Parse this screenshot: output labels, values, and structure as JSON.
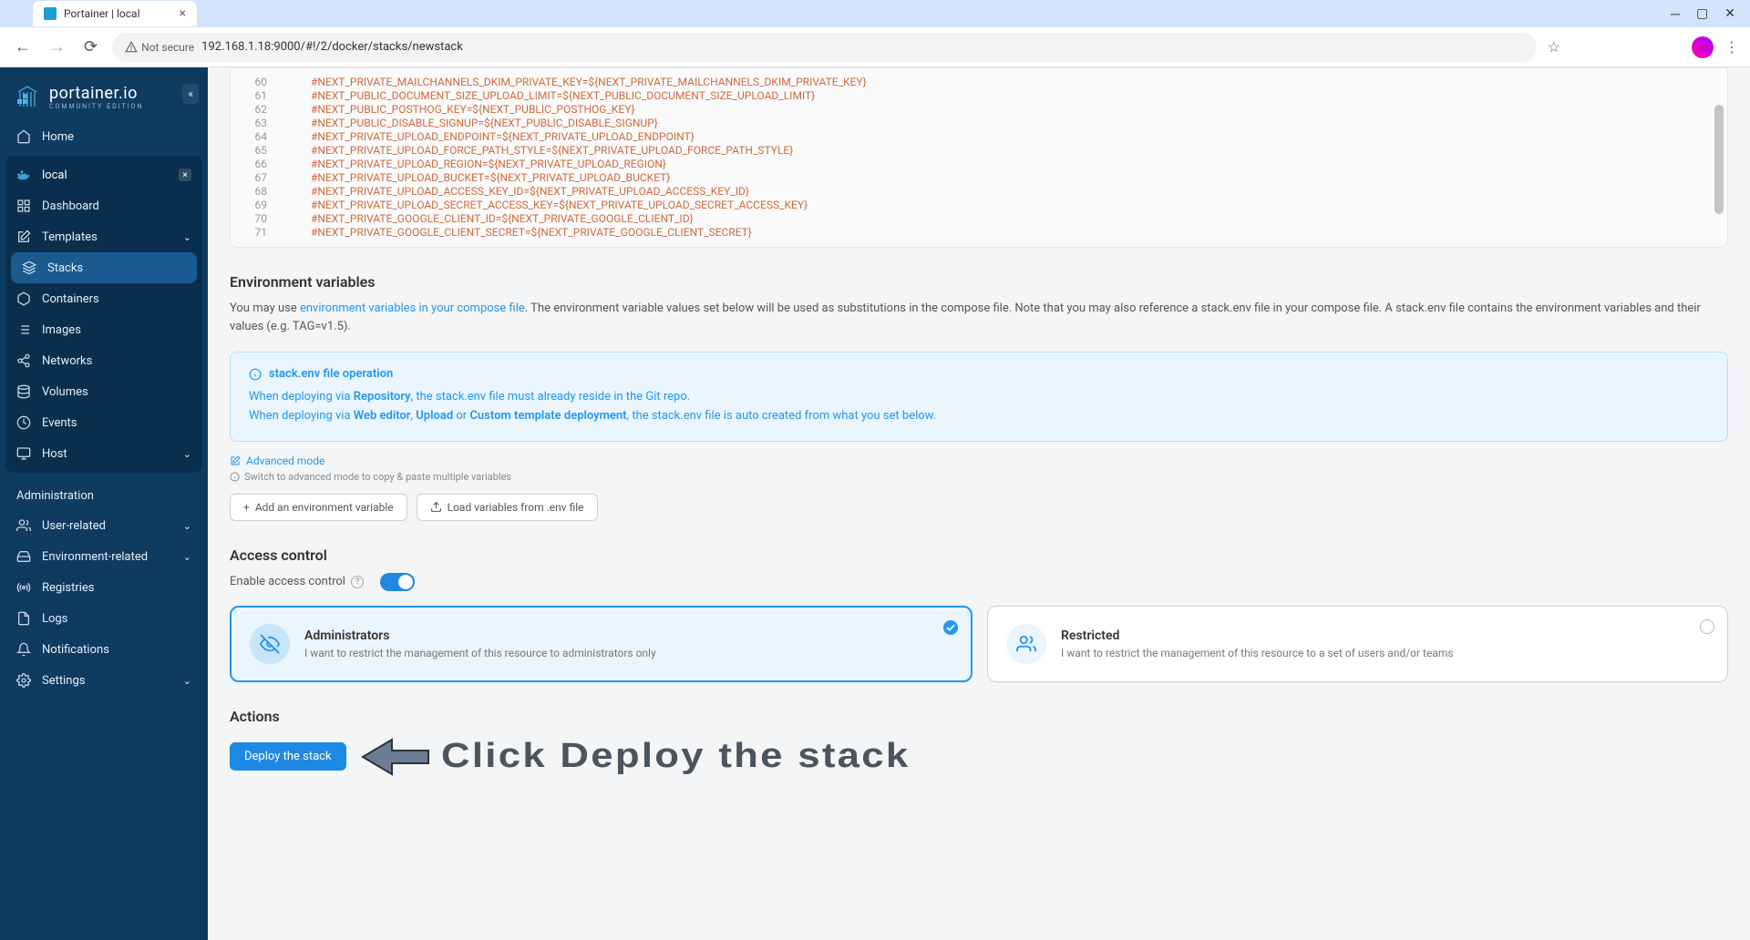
{
  "browser": {
    "tab_title": "Portainer | local",
    "not_secure": "Not secure",
    "url": "192.168.1.18:9000/#!/2/docker/stacks/newstack"
  },
  "sidebar": {
    "logo_main": "portainer.io",
    "logo_sub": "COMMUNITY EDITION",
    "home": "Home",
    "env_name": "local",
    "items": [
      "Dashboard",
      "Templates",
      "Stacks",
      "Containers",
      "Images",
      "Networks",
      "Volumes",
      "Events",
      "Host"
    ],
    "admin_header": "Administration",
    "admin_items": [
      "User-related",
      "Environment-related",
      "Registries",
      "Logs",
      "Notifications",
      "Settings"
    ]
  },
  "code": {
    "lines": [
      {
        "n": 60,
        "t": "#NEXT_PRIVATE_MAILCHANNELS_DKIM_PRIVATE_KEY=${NEXT_PRIVATE_MAILCHANNELS_DKIM_PRIVATE_KEY}"
      },
      {
        "n": 61,
        "t": "#NEXT_PUBLIC_DOCUMENT_SIZE_UPLOAD_LIMIT=${NEXT_PUBLIC_DOCUMENT_SIZE_UPLOAD_LIMIT}"
      },
      {
        "n": 62,
        "t": "#NEXT_PUBLIC_POSTHOG_KEY=${NEXT_PUBLIC_POSTHOG_KEY}"
      },
      {
        "n": 63,
        "t": "#NEXT_PUBLIC_DISABLE_SIGNUP=${NEXT_PUBLIC_DISABLE_SIGNUP}"
      },
      {
        "n": 64,
        "t": "#NEXT_PRIVATE_UPLOAD_ENDPOINT=${NEXT_PRIVATE_UPLOAD_ENDPOINT}"
      },
      {
        "n": 65,
        "t": "#NEXT_PRIVATE_UPLOAD_FORCE_PATH_STYLE=${NEXT_PRIVATE_UPLOAD_FORCE_PATH_STYLE}"
      },
      {
        "n": 66,
        "t": "#NEXT_PRIVATE_UPLOAD_REGION=${NEXT_PRIVATE_UPLOAD_REGION}"
      },
      {
        "n": 67,
        "t": "#NEXT_PRIVATE_UPLOAD_BUCKET=${NEXT_PRIVATE_UPLOAD_BUCKET}"
      },
      {
        "n": 68,
        "t": "#NEXT_PRIVATE_UPLOAD_ACCESS_KEY_ID=${NEXT_PRIVATE_UPLOAD_ACCESS_KEY_ID}"
      },
      {
        "n": 69,
        "t": "#NEXT_PRIVATE_UPLOAD_SECRET_ACCESS_KEY=${NEXT_PRIVATE_UPLOAD_SECRET_ACCESS_KEY}"
      },
      {
        "n": 70,
        "t": "#NEXT_PRIVATE_GOOGLE_CLIENT_ID=${NEXT_PRIVATE_GOOGLE_CLIENT_ID}"
      },
      {
        "n": 71,
        "t": "#NEXT_PRIVATE_GOOGLE_CLIENT_SECRET=${NEXT_PRIVATE_GOOGLE_CLIENT_SECRET}"
      }
    ]
  },
  "env": {
    "title": "Environment variables",
    "pre": "You may use ",
    "link": "environment variables in your compose file",
    "post": ". The environment variable values set below will be used as substitutions in the compose file. Note that you may also reference a stack.env file in your compose file. A stack.env file contains the environment variables and their values (e.g. TAG=v1.5).",
    "info_title": "stack.env file operation",
    "info_l1_a": "When deploying via ",
    "info_l1_b": "Repository",
    "info_l1_c": ", the stack.env file must already reside in the Git repo.",
    "info_l2_a": "When deploying via ",
    "info_l2_b": "Web editor",
    "info_l2_c": ", ",
    "info_l2_d": "Upload",
    "info_l2_e": " or ",
    "info_l2_f": "Custom template deployment",
    "info_l2_g": ", the stack.env file is auto created from what you set below.",
    "adv_mode": "Advanced mode",
    "hint": "Switch to advanced mode to copy & paste multiple variables",
    "btn_add": "Add an environment variable",
    "btn_load": "Load variables from .env file"
  },
  "access": {
    "title": "Access control",
    "enable": "Enable access control",
    "card1_title": "Administrators",
    "card1_desc": "I want to restrict the management of this resource to administrators only",
    "card2_title": "Restricted",
    "card2_desc": "I want to restrict the management of this resource to a set of users and/or teams"
  },
  "actions": {
    "title": "Actions",
    "deploy": "Deploy the stack",
    "annotation": "Click Deploy the stack"
  }
}
